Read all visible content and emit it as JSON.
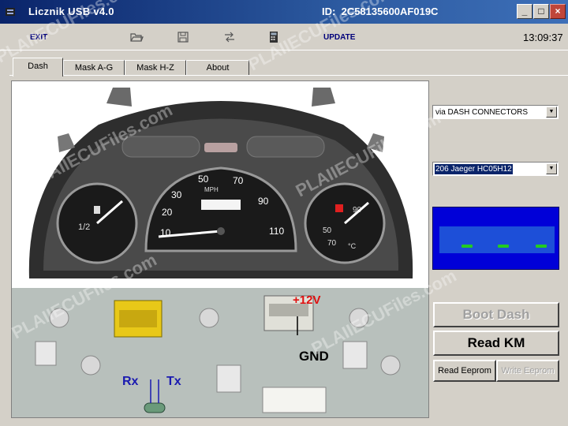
{
  "window": {
    "title": "Licznik USB v4.0",
    "id_label": "ID:",
    "id_value": "2C58135600AF019C",
    "minimize": "_",
    "maximize": "□",
    "close": "×"
  },
  "toolbar": {
    "exit_label": "EXIT",
    "update_label": "UPDATE",
    "clock": "13:09:37"
  },
  "tabs": [
    {
      "label": "Dash"
    },
    {
      "label": "Mask A-G"
    },
    {
      "label": "Mask H-Z"
    },
    {
      "label": "About"
    }
  ],
  "side": {
    "connection_select": "via DASH CONNECTORS",
    "model_select": "206 Jaeger HC05H12",
    "boot_dash": "Boot Dash",
    "read_km": "Read KM",
    "read_eeprom": "Read Eeprom",
    "write_eeprom": "Write Eeprom"
  },
  "photo": {
    "label_12v": "+12V",
    "label_gnd": "GND",
    "label_rx": "Rx",
    "label_tx": "Tx",
    "dial_mph": "MPH",
    "speed_ticks": [
      "10",
      "20",
      "30",
      "50",
      "70",
      "90",
      "110"
    ],
    "fuel_half": "1/2",
    "temp_ticks": [
      "50",
      "70",
      "90"
    ],
    "temp_unit": "°C"
  },
  "watermark": "PLAIIECUFiles.com",
  "colors": {
    "titlebar": "#0a246a",
    "lcd": "#0000d8",
    "segment": "#22cc22",
    "label_red": "#e01010",
    "label_blue": "#1a1ab0"
  }
}
